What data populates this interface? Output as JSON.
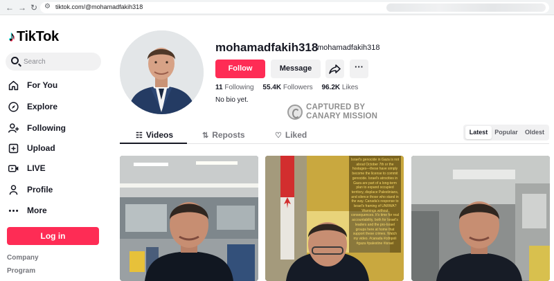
{
  "browser": {
    "url": "tiktok.com/@mohamadfakih318",
    "nav_icons": [
      "back-icon",
      "forward-icon",
      "reload-icon",
      "site-settings-icon"
    ]
  },
  "sidebar": {
    "logo_text": "TikTok",
    "search_placeholder": "Search",
    "items": [
      {
        "label": "For You",
        "icon": "home-icon"
      },
      {
        "label": "Explore",
        "icon": "compass-icon"
      },
      {
        "label": "Following",
        "icon": "user-plus-icon"
      },
      {
        "label": "Upload",
        "icon": "plus-square-icon"
      },
      {
        "label": "LIVE",
        "icon": "live-camera-icon"
      },
      {
        "label": "Profile",
        "icon": "person-icon"
      },
      {
        "label": "More",
        "icon": "ellipsis-icon"
      }
    ],
    "login_label": "Log in",
    "footer_links": [
      "Company",
      "Program"
    ]
  },
  "profile": {
    "username": "mohamadfakih318",
    "nickname": "mohamadfakih318",
    "follow_label": "Follow",
    "message_label": "Message",
    "more_label": "···",
    "following_count": "11",
    "following_label": "Following",
    "followers_count": "55.4K",
    "followers_label": "Followers",
    "likes_count": "96.2K",
    "likes_label": "Likes",
    "bio": "No bio yet."
  },
  "watermark": {
    "line1": "CAPTURED BY",
    "line2": "CANARY MISSION"
  },
  "tabs": [
    {
      "label": "Videos",
      "icon": "grid-icon",
      "active": true
    },
    {
      "label": "Reposts",
      "icon": "repost-icon",
      "active": false
    },
    {
      "label": "Liked",
      "icon": "heart-outline-icon",
      "active": false
    }
  ],
  "sort": {
    "options": [
      "Latest",
      "Popular",
      "Oldest"
    ],
    "selected": "Latest"
  },
  "videos": [
    {
      "thumbnail": "man-in-office-cafeteria"
    },
    {
      "thumbnail": "man-with-canadian-flag",
      "caption": "Israel's genocide in Gaza is not about October 7th or the hostages—these have simply become the license to commit genocide. Israel's atrocities in Gaza are part of a long-term plan to expand occupied territory, displace Palestinians, and silence those who stand in the way. Canada's response to Israel's framing of UNRWA? Warnings without consequences. It's time for real accountability, both for Israel's leaders and the pro-Israel groups here at home that support these crimes. Watch my video. #canada #cdnpoli #gaza #palestine #israel"
    },
    {
      "thumbnail": "man-in-kitchen"
    }
  ],
  "colors": {
    "brand_red": "#fe2c55",
    "text_primary": "#161823",
    "text_secondary": "#75767c",
    "surface_gray": "#f1f1f2"
  }
}
